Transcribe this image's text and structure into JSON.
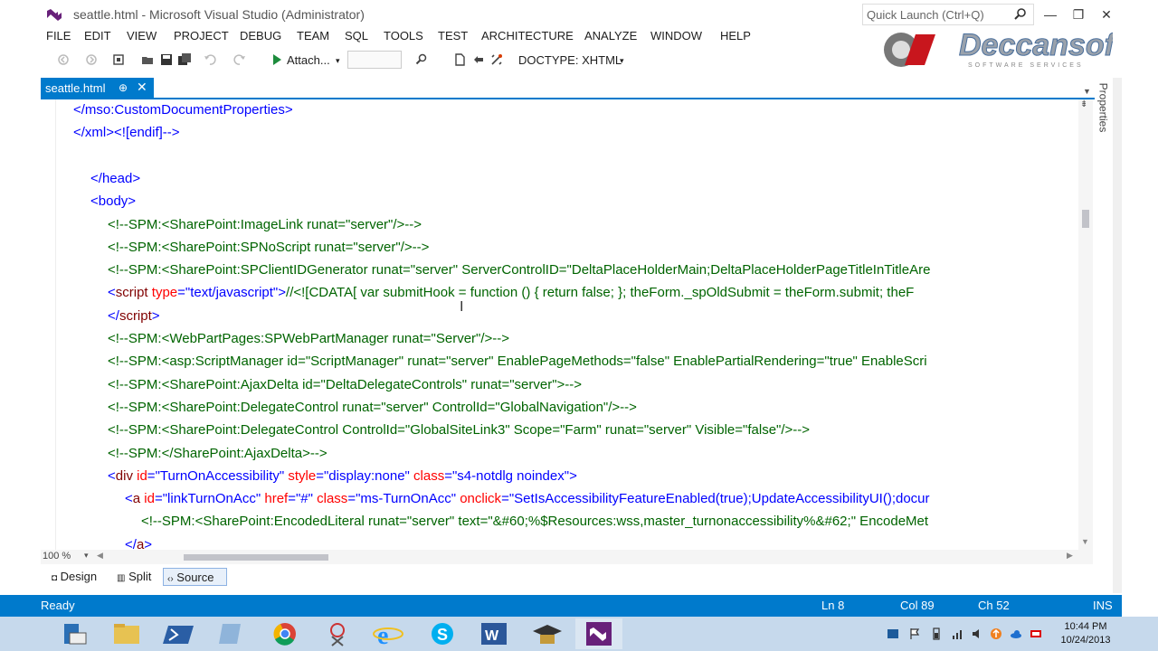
{
  "window": {
    "title": "seattle.html - Microsoft Visual Studio (Administrator)",
    "quick_launch_placeholder": "Quick Launch (Ctrl+Q)",
    "minimize_label": "—",
    "restore_label": "❐",
    "close_label": "✕"
  },
  "menu": [
    "FILE",
    "EDIT",
    "VIEW",
    "PROJECT",
    "DEBUG",
    "TEAM",
    "SQL",
    "TOOLS",
    "TEST",
    "ARCHITECTURE",
    "ANALYZE",
    "WINDOW",
    "HELP"
  ],
  "toolbar": {
    "attach_label": "Attach...",
    "doctype_label": "DOCTYPE: XHTML"
  },
  "brand": {
    "name": "Deccansoft",
    "tagline": "SOFTWARE SERVICES"
  },
  "tab": {
    "label": "seattle.html",
    "pin_glyph": "⊕",
    "close_glyph": "✕"
  },
  "properties_label": "Properties",
  "code_lines": [
    [
      {
        "t": "</mso:CustomDocumentProperties>",
        "c": "tag"
      }
    ],
    [
      {
        "t": "</xml><![endif]-->",
        "c": "tag"
      }
    ],
    [],
    [
      {
        "t": "</",
        "c": "tag"
      },
      {
        "t": "head",
        "c": "tag"
      },
      {
        "t": ">",
        "c": "tag"
      }
    ],
    [
      {
        "t": "<",
        "c": "tag"
      },
      {
        "t": "body",
        "c": "tag"
      },
      {
        "t": ">",
        "c": "tag"
      }
    ],
    [
      {
        "t": "<!--SPM:<SharePoint:ImageLink runat=\"server\"/>-->",
        "c": "comment"
      }
    ],
    [
      {
        "t": "<!--SPM:<SharePoint:SPNoScript runat=\"server\"/>-->",
        "c": "comment"
      }
    ],
    [
      {
        "t": "<!--SPM:<SharePoint:SPClientIDGenerator runat=\"server\" ServerControlID=\"DeltaPlaceHolderMain;DeltaPlaceHolderPageTitleInTitleAre",
        "c": "comment"
      }
    ],
    [
      {
        "t": "<",
        "c": "tag"
      },
      {
        "t": "script",
        "c": "tagname"
      },
      {
        "t": " type",
        "c": "attr"
      },
      {
        "t": "=",
        "c": "tag"
      },
      {
        "t": "\"text/javascript\"",
        "c": "val"
      },
      {
        "t": ">",
        "c": "tag"
      },
      {
        "t": "//<![CDATA[ var submitHook = function () { return false; }; theForm._spOldSubmit = theForm.submit; theF",
        "c": "comment"
      }
    ],
    [
      {
        "t": "</",
        "c": "tag"
      },
      {
        "t": "script",
        "c": "tagname"
      },
      {
        "t": ">",
        "c": "tag"
      }
    ],
    [
      {
        "t": "<!--SPM:<WebPartPages:SPWebPartManager runat=\"Server\"/>-->",
        "c": "comment"
      }
    ],
    [
      {
        "t": "<!--SPM:<asp:ScriptManager id=\"ScriptManager\" runat=\"server\" EnablePageMethods=\"false\" EnablePartialRendering=\"true\" EnableScri",
        "c": "comment"
      }
    ],
    [
      {
        "t": "<!--SPM:<SharePoint:AjaxDelta id=\"DeltaDelegateControls\" runat=\"server\">-->",
        "c": "comment"
      }
    ],
    [
      {
        "t": "<!--SPM:<SharePoint:DelegateControl runat=\"server\" ControlId=\"GlobalNavigation\"/>-->",
        "c": "comment"
      }
    ],
    [
      {
        "t": "<!--SPM:<SharePoint:DelegateControl ControlId=\"GlobalSiteLink3\" Scope=\"Farm\" runat=\"server\" Visible=\"false\"/>-->",
        "c": "comment"
      }
    ],
    [
      {
        "t": "<!--SPM:</SharePoint:AjaxDelta>-->",
        "c": "comment"
      }
    ],
    [
      {
        "t": "<",
        "c": "tag"
      },
      {
        "t": "div",
        "c": "tagname"
      },
      {
        "t": " id",
        "c": "attr"
      },
      {
        "t": "=",
        "c": "tag"
      },
      {
        "t": "\"TurnOnAccessibility\"",
        "c": "val"
      },
      {
        "t": " style",
        "c": "attr"
      },
      {
        "t": "=",
        "c": "tag"
      },
      {
        "t": "\"display:none\"",
        "c": "val"
      },
      {
        "t": " class",
        "c": "attr"
      },
      {
        "t": "=",
        "c": "tag"
      },
      {
        "t": "\"s4-notdlg noindex\"",
        "c": "val"
      },
      {
        "t": ">",
        "c": "tag"
      }
    ],
    [
      {
        "t": "<",
        "c": "tag"
      },
      {
        "t": "a",
        "c": "tagname"
      },
      {
        "t": " id",
        "c": "attr"
      },
      {
        "t": "=",
        "c": "tag"
      },
      {
        "t": "\"linkTurnOnAcc\"",
        "c": "val"
      },
      {
        "t": " href",
        "c": "attr"
      },
      {
        "t": "=",
        "c": "tag"
      },
      {
        "t": "\"#\"",
        "c": "val"
      },
      {
        "t": " class",
        "c": "attr"
      },
      {
        "t": "=",
        "c": "tag"
      },
      {
        "t": "\"ms-TurnOnAcc\"",
        "c": "val"
      },
      {
        "t": " onclick",
        "c": "attr"
      },
      {
        "t": "=",
        "c": "tag"
      },
      {
        "t": "\"SetIsAccessibilityFeatureEnabled(true);UpdateAccessibilityUI();docur",
        "c": "val"
      }
    ],
    [
      {
        "t": "<!--SPM:<SharePoint:EncodedLiteral runat=\"server\" text=\"&#60;%$Resources:wss,master_turnonaccessibility%&#62;\" EncodeMet",
        "c": "comment"
      }
    ],
    [
      {
        "t": "</",
        "c": "tag"
      },
      {
        "t": "a",
        "c": "tagname"
      },
      {
        "t": ">",
        "c": "tag"
      }
    ]
  ],
  "colors": {
    "tag": "#0000ff",
    "tagname": "#800000",
    "attr": "#ff0000",
    "val": "#0000ff",
    "comment": "#006400",
    "accent": "#007acc"
  },
  "editor": {
    "zoom": "100 %"
  },
  "views": {
    "design": "Design",
    "split": "Split",
    "source": "Source"
  },
  "status": {
    "state": "Ready",
    "line": "Ln 8",
    "col": "Col 89",
    "ch": "Ch 52",
    "mode": "INS"
  },
  "taskbar": {
    "apps": [
      "server-manager-icon",
      "file-explorer-icon",
      "powershell-icon",
      "notepad-icon",
      "chrome-icon",
      "snipping-tool-icon",
      "internet-explorer-icon",
      "skype-icon",
      "word-icon",
      "graduation-icon",
      "visual-studio-icon"
    ],
    "time": "10:44 PM",
    "date": "10/24/2013"
  }
}
